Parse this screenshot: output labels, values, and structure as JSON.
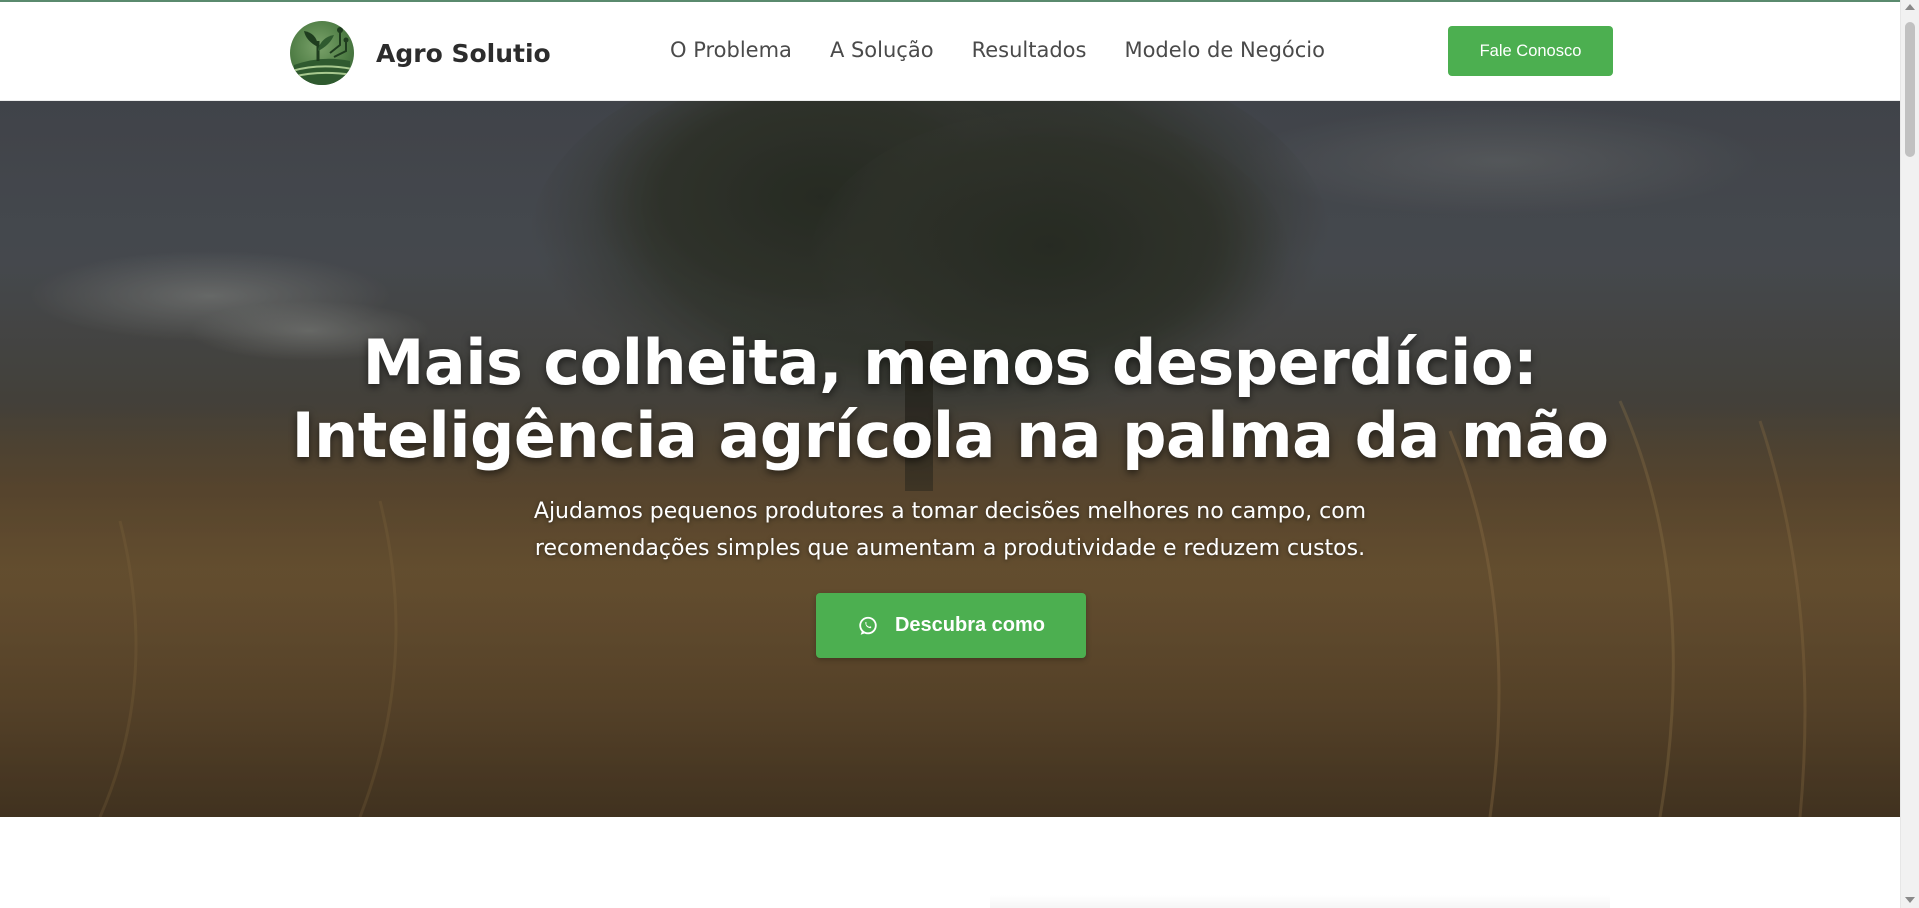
{
  "brand": {
    "name": "Agro Solutio",
    "logo_icon": "leaf-circuit-logo-icon"
  },
  "nav": {
    "items": [
      {
        "label": "O Problema"
      },
      {
        "label": "A Solução"
      },
      {
        "label": "Resultados"
      },
      {
        "label": "Modelo de Negócio"
      }
    ],
    "cta_label": "Fale Conosco"
  },
  "hero": {
    "title_line1": "Mais colheita, menos desperdício:",
    "title_line2": "Inteligência agrícola na palma da mão",
    "subtitle_line1": "Ajudamos pequenos produtores a tomar decisões melhores no campo, com",
    "subtitle_line2": "recomendações simples que aumentam a produtividade e reduzem custos.",
    "button_label": "Descubra como",
    "button_icon": "whatsapp-icon",
    "background": "wheat-field-with-tree"
  },
  "colors": {
    "accent": "#4caf50",
    "nav_text": "#4a4a4a",
    "brand_text": "#2c2c2c"
  }
}
